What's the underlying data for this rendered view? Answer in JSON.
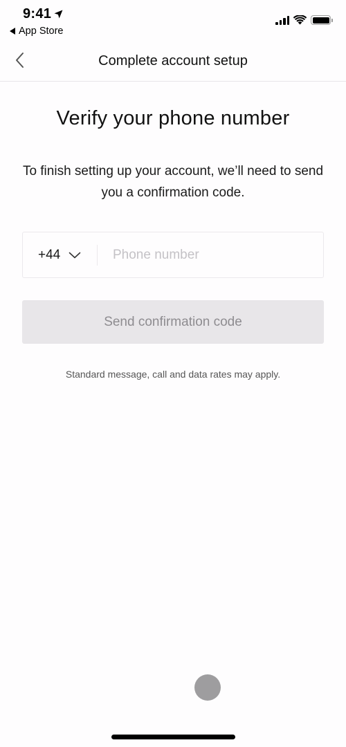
{
  "status_bar": {
    "time": "9:41",
    "location_icon": "location-arrow-icon",
    "back_app_label": "App Store",
    "icons": [
      "cellular-signal-icon",
      "wifi-icon",
      "battery-icon"
    ]
  },
  "nav": {
    "back_icon": "chevron-left-icon",
    "title": "Complete account setup"
  },
  "main": {
    "heading": "Verify your phone number",
    "subtitle": "To finish setting up your account, we’ll need to send you a confirmation code.",
    "phone_field": {
      "country_code": "+44",
      "country_dropdown_icon": "chevron-down-icon",
      "value": "",
      "placeholder": "Phone number"
    },
    "send_button": {
      "label": "Send confirmation code",
      "state": "disabled"
    },
    "disclaimer": "Standard message, call and data rates may apply."
  },
  "colors": {
    "background": "#fefdfe",
    "button_disabled_bg": "#e8e6e9",
    "button_disabled_text": "#8e8c90",
    "placeholder": "#c4c2c6",
    "divider": "#e7e5e9"
  }
}
